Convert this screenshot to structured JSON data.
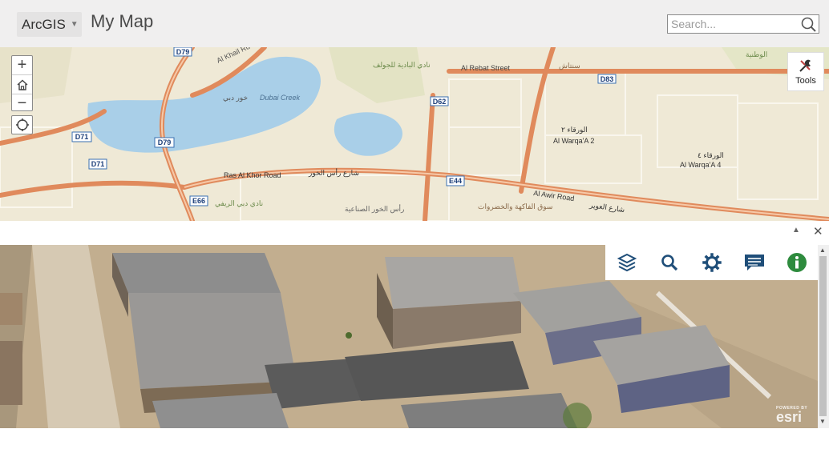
{
  "header": {
    "app_menu_label": "ArcGIS",
    "map_title": "My Map",
    "search_placeholder": "Search..."
  },
  "map2d": {
    "tools_label": "Tools",
    "road_shields": [
      "D79",
      "D71",
      "D79",
      "D71",
      "D62",
      "D83",
      "E44",
      "E66"
    ],
    "labels": {
      "al_khail": "Al Khail Rd",
      "dubai_creek_ar": "خور دبي",
      "dubai_creek": "Dubai Creek",
      "golf_club_ar": "نادي البادية للجولف",
      "al_rebat": "Al Rebat Street",
      "al_warqa2_ar": "الورقاء ٢",
      "al_warqa2": "Al Warqa'A 2",
      "al_warqa4_ar": "الورقاء ٤",
      "al_warqa4": "Al Warqa'A 4",
      "ras_al_khor": "Ras Al Khor Road",
      "ras_al_khor_ar": "شارع رأس الخور",
      "al_awir": "Al Awir Road",
      "al_awir_ar": "شارع العوير",
      "ras_al_khor_ind_ar": "رأس الخور الصناعية",
      "dubai_club_ar": "نادي دبي الريفي",
      "fruit_market_ar": "سوق الفاكهة والخضروات",
      "al_wataniya_ar": "الوطنية",
      "sintash_ar": "سنتاش"
    }
  },
  "scene": {
    "toolbar": [
      "layers-icon",
      "search-icon",
      "settings-icon",
      "comment-icon",
      "info-icon"
    ],
    "logo": "esri",
    "logo_small": "POWERED BY"
  },
  "colors": {
    "header_bg": "#f0efef",
    "road_major": "#e08a5c",
    "water": "#a9cfe8",
    "toolbar_icon": "#1f4e79",
    "info_icon": "#2e8b3e"
  }
}
